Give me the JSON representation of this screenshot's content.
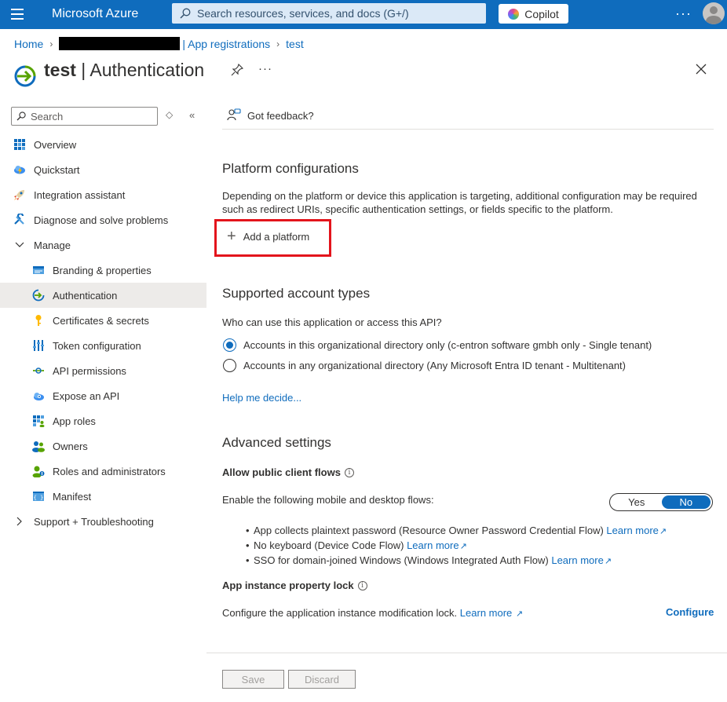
{
  "topbar": {
    "brand": "Microsoft Azure",
    "search_placeholder": "Search resources, services, and docs (G+/)",
    "copilot_label": "Copilot",
    "more": "···"
  },
  "breadcrumb": {
    "home": "Home",
    "app_registrations": "| App registrations",
    "current": "test"
  },
  "header": {
    "app_name": "test",
    "separator": " | ",
    "page": "Authentication",
    "more": "···"
  },
  "sidebar": {
    "search_placeholder": "Search",
    "items": [
      {
        "label": "Overview"
      },
      {
        "label": "Quickstart"
      },
      {
        "label": "Integration assistant"
      },
      {
        "label": "Diagnose and solve problems"
      },
      {
        "label": "Manage"
      },
      {
        "label": "Branding & properties"
      },
      {
        "label": "Authentication"
      },
      {
        "label": "Certificates & secrets"
      },
      {
        "label": "Token configuration"
      },
      {
        "label": "API permissions"
      },
      {
        "label": "Expose an API"
      },
      {
        "label": "App roles"
      },
      {
        "label": "Owners"
      },
      {
        "label": "Roles and administrators"
      },
      {
        "label": "Manifest"
      },
      {
        "label": "Support + Troubleshooting"
      }
    ]
  },
  "main": {
    "feedback": "Got feedback?",
    "platform": {
      "title": "Platform configurations",
      "description": "Depending on the platform or device this application is targeting, additional configuration may be required such as redirect URIs, specific authentication settings, or fields specific to the platform.",
      "add_label": "Add a platform"
    },
    "accounts": {
      "title": "Supported account types",
      "question": "Who can use this application or access this API?",
      "option_single": "Accounts in this organizational directory only (c-entron software gmbh only - Single tenant)",
      "option_multi": "Accounts in any organizational directory (Any Microsoft Entra ID tenant - Multitenant)",
      "help": "Help me decide..."
    },
    "advanced": {
      "title": "Advanced settings",
      "public_flows_label": "Allow public client flows",
      "flows_text": "Enable the following mobile and desktop flows:",
      "toggle_yes": "Yes",
      "toggle_no": "No",
      "bullets": [
        {
          "text": "App collects plaintext password (Resource Owner Password Credential Flow) ",
          "link": "Learn more"
        },
        {
          "text": "No keyboard (Device Code Flow) ",
          "link": "Learn more"
        },
        {
          "text": "SSO for domain-joined Windows (Windows Integrated Auth Flow) ",
          "link": "Learn more"
        }
      ],
      "lock_label": "App instance property lock",
      "lock_text": "Configure the application instance modification lock. ",
      "lock_link": "Learn more",
      "configure": "Configure"
    },
    "buttons": {
      "save": "Save",
      "discard": "Discard"
    }
  },
  "colors": {
    "accent": "#0f6cbd",
    "highlight_border": "#e3141c"
  }
}
